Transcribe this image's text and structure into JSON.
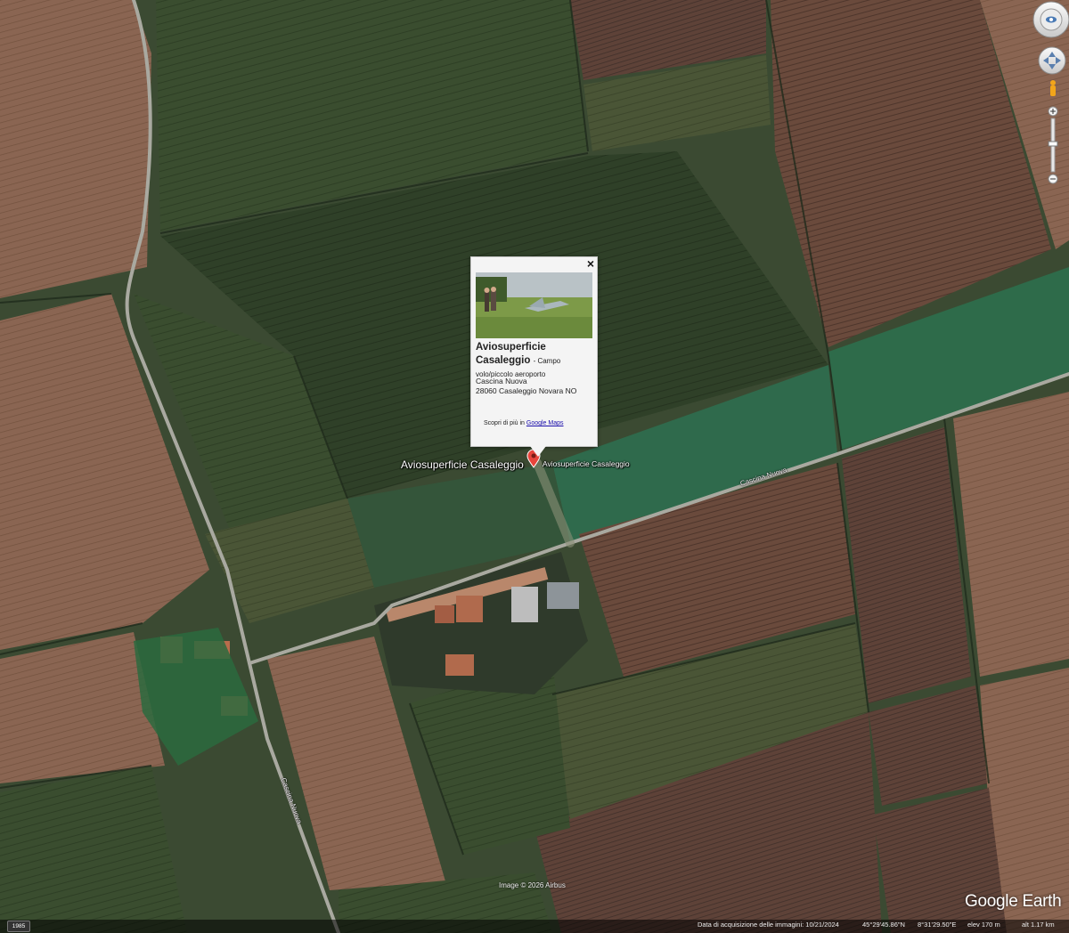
{
  "map": {
    "imagery_copyright": "Image © 2026 Airbus",
    "brand": "Google Earth"
  },
  "placemark": {
    "label": "Aviosuperficie Casaleggio",
    "label_small": "Aviosuperficie Casaleggio",
    "pin_color": "#e8453c"
  },
  "popup": {
    "close_label": "×",
    "title_line1": "Aviosuperficie",
    "title_line2": "Casaleggio",
    "category": "- Campo volo/piccolo aeroporto",
    "address_line1": "Cascina Nuova",
    "address_line2": "28060 Casaleggio Novara NO",
    "more_prefix": "Scopri di più in",
    "more_link": "Google Maps"
  },
  "roads": {
    "cascina_nuova_east": "Cascina Nuova",
    "cascina_nuova_south": "Cascina Nuova"
  },
  "status": {
    "year": "1985",
    "acquisition": "Data di acquisizione delle immagini: 10/21/2024",
    "lat": "45°29'45.86\"N",
    "lon": "8°31'29.50\"E",
    "elev": "elev  170 m",
    "eye_alt": "alt  1.17 km"
  }
}
